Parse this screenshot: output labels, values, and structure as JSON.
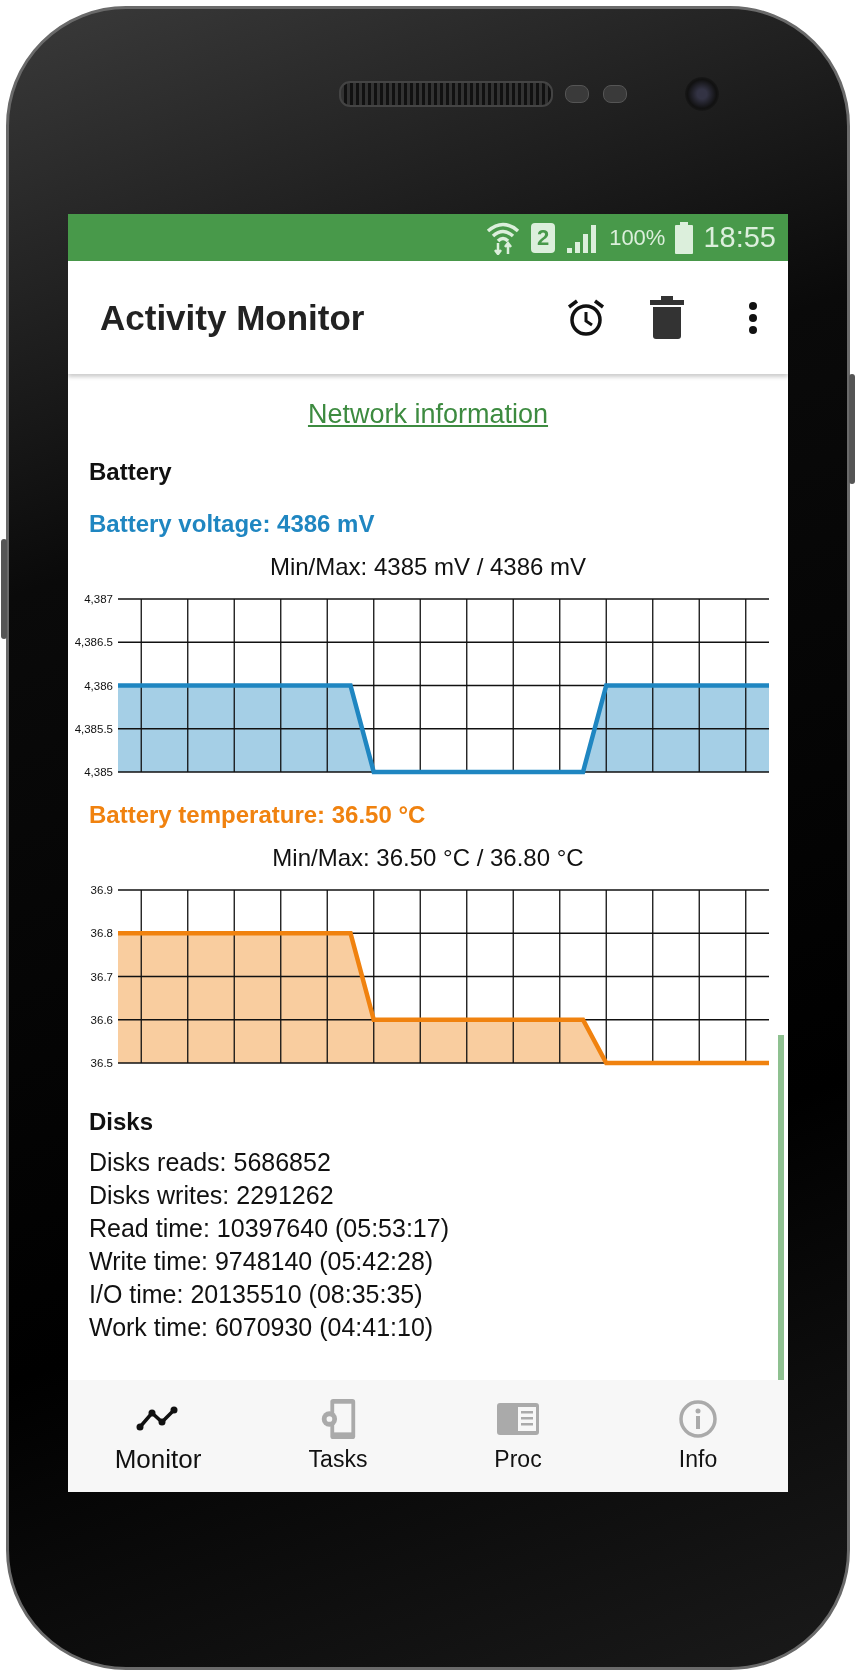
{
  "status_bar": {
    "sim": "2",
    "battery": "100%",
    "time": "18:55"
  },
  "app_bar": {
    "title": "Activity Monitor"
  },
  "link": "Network information",
  "battery": {
    "heading": "Battery",
    "charts": [
      {
        "label": "Battery voltage: 4386 mV",
        "color": "#1f86c1",
        "chart_data": {
          "type": "area",
          "grid": true,
          "title": "Min/Max: 4385 mV / 4386 mV",
          "categories": [
            null,
            null,
            null,
            null,
            null,
            null,
            null,
            null,
            null,
            null,
            null,
            null,
            null,
            null,
            null,
            null,
            null,
            null,
            null,
            null,
            null,
            null,
            null,
            null,
            null,
            null,
            null,
            null,
            null
          ],
          "series": [
            {
              "color": "#1f86c1",
              "values": [
                4386,
                4386,
                4386,
                4386,
                4386,
                4386,
                4386,
                4386,
                4386,
                4386,
                4386,
                4385,
                4385,
                4385,
                4385,
                4385,
                4385,
                4385,
                4385,
                4385,
                4385,
                4386,
                4386,
                4386,
                4386,
                4386,
                4386,
                4386,
                4386
              ]
            }
          ],
          "ylim": [
            4385,
            4387
          ],
          "yticks": [
            {
              "value": 4385,
              "label": "4,385"
            },
            {
              "value": 4385.5,
              "label": "4,385.5"
            },
            {
              "value": 4386,
              "label": "4,386"
            },
            {
              "value": 4386.5,
              "label": "4,386.5"
            },
            {
              "value": 4387,
              "label": "4,387"
            }
          ]
        }
      },
      {
        "label": "Battery temperature: 36.50 °C",
        "color": "#f0820f",
        "chart_data": {
          "type": "area",
          "grid": true,
          "title": "Min/Max: 36.50 °C / 36.80 °C",
          "categories": [
            null,
            null,
            null,
            null,
            null,
            null,
            null,
            null,
            null,
            null,
            null,
            null,
            null,
            null,
            null,
            null,
            null,
            null,
            null,
            null,
            null,
            null,
            null,
            null,
            null,
            null,
            null,
            null,
            null
          ],
          "series": [
            {
              "color": "#f0820f",
              "values": [
                36.8,
                36.8,
                36.8,
                36.8,
                36.8,
                36.8,
                36.8,
                36.8,
                36.8,
                36.8,
                36.8,
                36.6,
                36.6,
                36.6,
                36.6,
                36.6,
                36.6,
                36.6,
                36.6,
                36.6,
                36.6,
                36.5,
                36.5,
                36.5,
                36.5,
                36.5,
                36.5,
                36.5,
                36.5
              ]
            }
          ],
          "ylim": [
            36.5,
            36.9
          ],
          "yticks": [
            {
              "value": 36.5,
              "label": "36.5"
            },
            {
              "value": 36.6,
              "label": "36.6"
            },
            {
              "value": 36.7,
              "label": "36.7"
            },
            {
              "value": 36.8,
              "label": "36.8"
            },
            {
              "value": 36.9,
              "label": "36.9"
            }
          ]
        }
      }
    ]
  },
  "disks": {
    "heading": "Disks",
    "lines": [
      "Disks reads: 5686852",
      "Disks writes: 2291262",
      "Read time: 10397640 (05:53:17)",
      "Write time: 9748140 (05:42:28)",
      "I/O time: 20135510 (08:35:35)",
      "Work time: 6070930 (04:41:10)"
    ]
  },
  "bottom_nav": [
    {
      "label": "Monitor",
      "selected": true
    },
    {
      "label": "Tasks",
      "selected": false
    },
    {
      "label": "Proc",
      "selected": false
    },
    {
      "label": "Info",
      "selected": false
    }
  ]
}
